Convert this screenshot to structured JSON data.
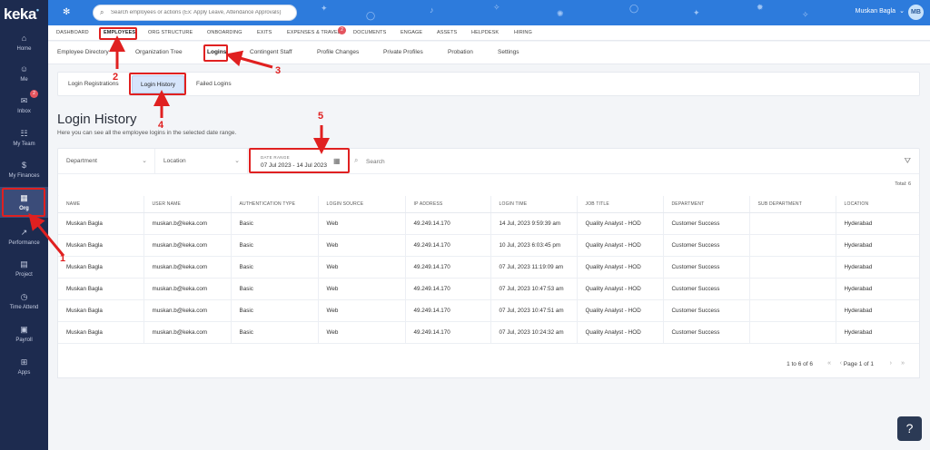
{
  "brand": {
    "logo": "keka",
    "logo_mark": "•"
  },
  "sidebar": {
    "items": [
      {
        "label": "Home",
        "icon": "home-icon",
        "glyph": "⌂"
      },
      {
        "label": "Me",
        "icon": "person-icon",
        "glyph": "☺"
      },
      {
        "label": "Inbox",
        "icon": "inbox-icon",
        "glyph": "✉",
        "badge": "2"
      },
      {
        "label": "My Team",
        "icon": "team-icon",
        "glyph": "☷"
      },
      {
        "label": "My Finances",
        "icon": "finance-icon",
        "glyph": "$"
      },
      {
        "label": "Org",
        "icon": "org-icon",
        "glyph": "▦"
      },
      {
        "label": "Performance",
        "icon": "performance-icon",
        "glyph": "↗"
      },
      {
        "label": "Project",
        "icon": "project-icon",
        "glyph": "▤"
      },
      {
        "label": "Time Attend",
        "icon": "clock-icon",
        "glyph": "◷"
      },
      {
        "label": "Payroll",
        "icon": "payroll-icon",
        "glyph": "▣"
      },
      {
        "label": "Apps",
        "icon": "apps-icon",
        "glyph": "⊞"
      }
    ]
  },
  "header": {
    "search_placeholder": "Search employees or actions (Ex: Apply Leave, Attendance Approvals)",
    "user_name": "Muskan Bagla",
    "avatar_initials": "MB"
  },
  "main_nav": {
    "items": [
      "DASHBOARD",
      "EMPLOYEES",
      "ORG STRUCTURE",
      "ONBOARDING",
      "EXITS",
      "EXPENSES & TRAVEL",
      "DOCUMENTS",
      "ENGAGE",
      "ASSETS",
      "HELPDESK",
      "HIRING"
    ],
    "expenses_badge": "2"
  },
  "sub_nav": {
    "items": [
      "Employee Directory",
      "Organization Tree",
      "Logins",
      "Contingent Staff",
      "Profile Changes",
      "Private Profiles",
      "Probation",
      "Settings"
    ]
  },
  "tabs": {
    "items": [
      "Login Registrations",
      "Login History",
      "Failed Logins"
    ]
  },
  "page": {
    "title": "Login History",
    "description": "Here you can see all the employee logins in the selected date range."
  },
  "filters": {
    "department": "Department",
    "location": "Location",
    "date_range_label": "DATE RANGE",
    "date_range_value": "07 Jul 2023 - 14 Jul 2023",
    "search_placeholder": "Search",
    "total": "Total: 6"
  },
  "table": {
    "columns": [
      "NAME",
      "USER NAME",
      "AUTHENTICATION TYPE",
      "LOGIN SOURCE",
      "IP ADDRESS",
      "LOGIN TIME",
      "JOB TITLE",
      "DEPARTMENT",
      "SUB DEPARTMENT",
      "LOCATION"
    ],
    "rows": [
      [
        "Muskan Bagla",
        "muskan.b@keka.com",
        "Basic",
        "Web",
        "49.249.14.170",
        "14 Jul, 2023 9:59:39 am",
        "Quality Analyst - HOD",
        "Customer Success",
        "",
        "Hyderabad"
      ],
      [
        "Muskan Bagla",
        "muskan.b@keka.com",
        "Basic",
        "Web",
        "49.249.14.170",
        "10 Jul, 2023 6:03:45 pm",
        "Quality Analyst - HOD",
        "Customer Success",
        "",
        "Hyderabad"
      ],
      [
        "Muskan Bagla",
        "muskan.b@keka.com",
        "Basic",
        "Web",
        "49.249.14.170",
        "07 Jul, 2023 11:19:09 am",
        "Quality Analyst - HOD",
        "Customer Success",
        "",
        "Hyderabad"
      ],
      [
        "Muskan Bagla",
        "muskan.b@keka.com",
        "Basic",
        "Web",
        "49.249.14.170",
        "07 Jul, 2023 10:47:53 am",
        "Quality Analyst - HOD",
        "Customer Success",
        "",
        "Hyderabad"
      ],
      [
        "Muskan Bagla",
        "muskan.b@keka.com",
        "Basic",
        "Web",
        "49.249.14.170",
        "07 Jul, 2023 10:47:51 am",
        "Quality Analyst - HOD",
        "Customer Success",
        "",
        "Hyderabad"
      ],
      [
        "Muskan Bagla",
        "muskan.b@keka.com",
        "Basic",
        "Web",
        "49.249.14.170",
        "07 Jul, 2023 10:24:32 am",
        "Quality Analyst - HOD",
        "Customer Success",
        "",
        "Hyderabad"
      ]
    ]
  },
  "pager": {
    "count": "1 to 6 of 6",
    "page": "Page 1 of 1"
  },
  "help": {
    "label": "?"
  },
  "annotations": {
    "labels": [
      "1",
      "2",
      "3",
      "4",
      "5"
    ],
    "color": "#e02020"
  },
  "colors": {
    "topbar": "#2d7bdc",
    "sidebar": "#1d2b4f",
    "active_tab": "#d6e5fb"
  }
}
